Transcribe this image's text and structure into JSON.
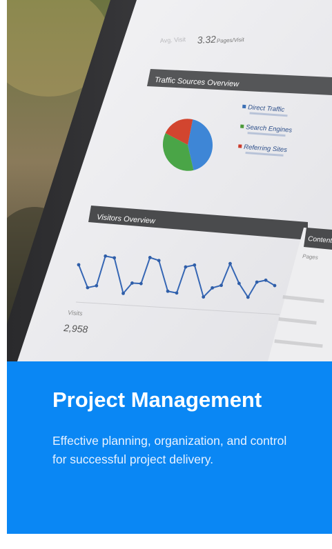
{
  "card": {
    "image": {
      "subject": "laptop-analytics-dashboard",
      "screen": {
        "stat_value": "3.32",
        "stat_label": "Pages/Visit",
        "traffic_sources_title": "Traffic Sources Overview",
        "legend": [
          {
            "label": "Direct Traffic",
            "color": "#3b6fb5"
          },
          {
            "label": "Search Engines",
            "color": "#4c9a3a"
          },
          {
            "label": "Referring Sites",
            "color": "#cc3b2c"
          }
        ],
        "pie": [
          {
            "label": "Direct Traffic",
            "fraction": 0.43,
            "color": "#3e86d6"
          },
          {
            "label": "Search Engines",
            "fraction": 0.36,
            "color": "#4aa547"
          },
          {
            "label": "Referring Sites",
            "fraction": 0.21,
            "color": "#d2452f"
          }
        ],
        "visitors_title": "Visitors Overview",
        "content_title": "Content",
        "content_col": "Pages",
        "visits_label": "Visits",
        "visits_value": "2,958",
        "line_series": [
          55,
          18,
          22,
          72,
          70,
          12,
          30,
          30,
          74,
          70,
          20,
          18,
          62,
          66,
          14,
          30,
          35,
          72,
          40,
          18,
          44,
          48,
          40
        ]
      }
    },
    "panel": {
      "background": "#0a87f4",
      "title": "Project Management",
      "description": "Effective planning, organization, and control for successful project delivery."
    }
  }
}
